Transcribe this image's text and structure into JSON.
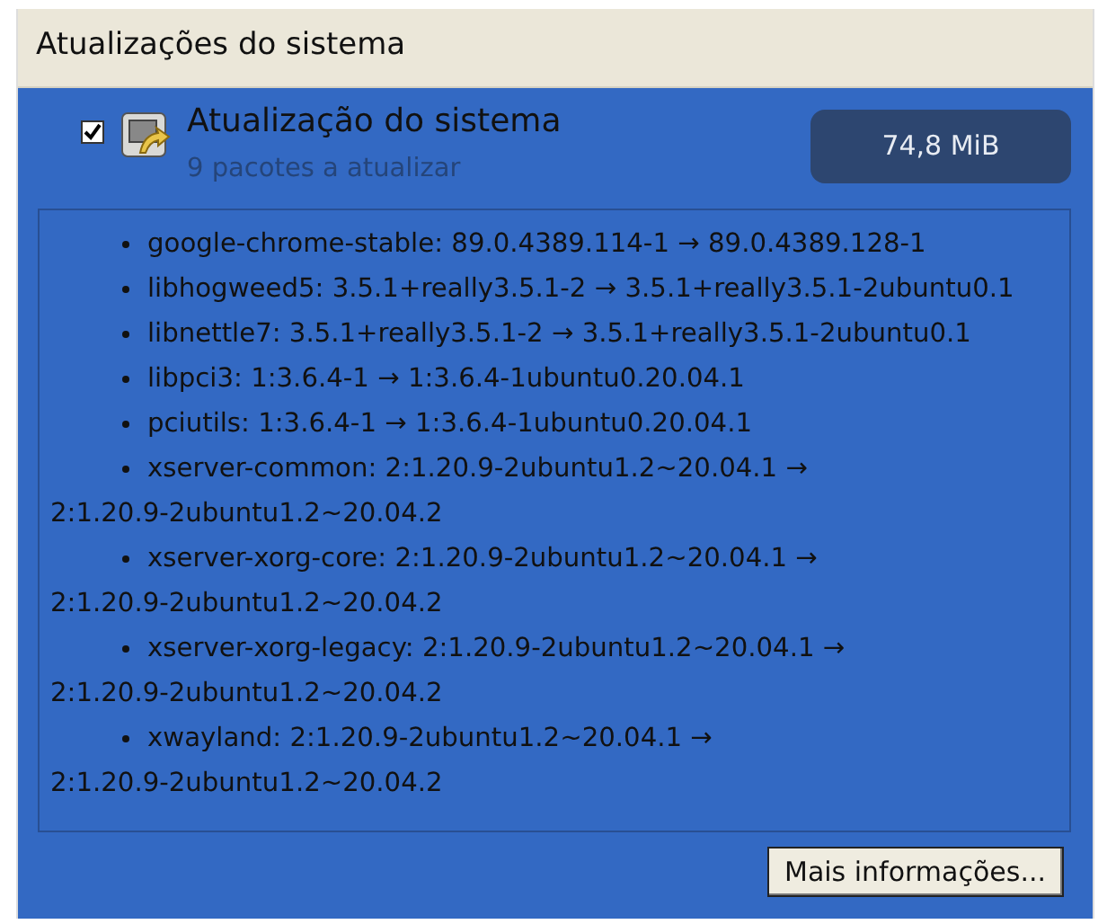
{
  "section": {
    "title": "Atualizações do sistema"
  },
  "update": {
    "checked": true,
    "title": "Atualização do sistema",
    "subtitle": "9 pacotes a atualizar",
    "size": "74,8 MiB"
  },
  "packages": [
    "google-chrome-stable: 89.0.4389.114-1 → 89.0.4389.128-1",
    "libhogweed5: 3.5.1+really3.5.1-2 → 3.5.1+really3.5.1-2ubuntu0.1",
    "libnettle7: 3.5.1+really3.5.1-2 → 3.5.1+really3.5.1-2ubuntu0.1",
    "libpci3: 1:3.6.4-1 → 1:3.6.4-1ubuntu0.20.04.1",
    "pciutils: 1:3.6.4-1 → 1:3.6.4-1ubuntu0.20.04.1",
    "xserver-common: 2:1.20.9-2ubuntu1.2~20.04.1 → 2:1.20.9-2ubuntu1.2~20.04.2",
    "xserver-xorg-core: 2:1.20.9-2ubuntu1.2~20.04.1 → 2:1.20.9-2ubuntu1.2~20.04.2",
    "xserver-xorg-legacy: 2:1.20.9-2ubuntu1.2~20.04.1 → 2:1.20.9-2ubuntu1.2~20.04.2",
    "xwayland: 2:1.20.9-2ubuntu1.2~20.04.1 → 2:1.20.9-2ubuntu1.2~20.04.2"
  ],
  "button": {
    "label": "Mais informações..."
  }
}
